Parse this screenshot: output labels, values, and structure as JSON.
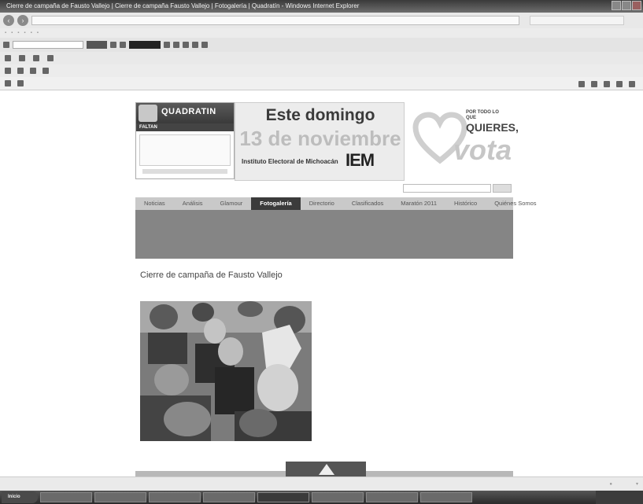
{
  "window": {
    "title": "Cierre de campaña de Fausto Vallejo | Cierre de campaña Fausto Vallejo | Fotogalería | Quadratín - Windows Internet Explorer"
  },
  "site": {
    "quadratin": {
      "logo": "QUADRATIN",
      "faltan": "FALTAN"
    },
    "banner": {
      "line1": "Este domingo",
      "line2": "13 de noviembre",
      "institute": "Instituto Electoral de Michoacán",
      "iem": "IEM"
    },
    "vota": {
      "small": "POR TODO LO QUE",
      "quieres": "QUIERES,",
      "word": "vota"
    },
    "nav": [
      {
        "label": "Noticias",
        "active": false
      },
      {
        "label": "Análisis",
        "active": false
      },
      {
        "label": "Glamour",
        "active": false
      },
      {
        "label": "Fotogalería",
        "active": true
      },
      {
        "label": "Directorio",
        "active": false
      },
      {
        "label": "Clasificados",
        "active": false
      },
      {
        "label": "Maratón 2011",
        "active": false
      },
      {
        "label": "Histórico",
        "active": false
      },
      {
        "label": "Quiénes Somos",
        "active": false
      }
    ]
  },
  "article": {
    "title": "Cierre de campaña de Fausto Vallejo"
  },
  "taskbar": {
    "start": "Inicio"
  }
}
